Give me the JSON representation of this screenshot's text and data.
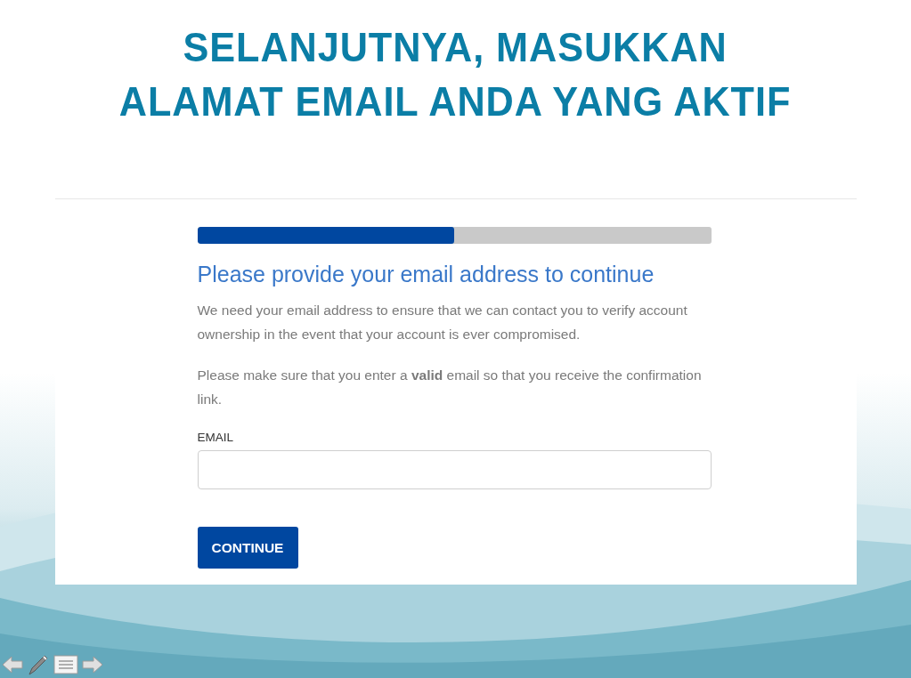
{
  "slide": {
    "title_lines": [
      "SELANJUTNYA, MASUKKAN",
      "ALAMAT EMAIL ANDA YANG AKTIF"
    ]
  },
  "form": {
    "progress": {
      "level": 0.5
    },
    "heading": "Please provide your email address to continue",
    "paragraphs": [
      "We need your email address to ensure that we can contact you to verify account ownership in the event that your account is ever compromised.",
      "Please make sure that you enter a **valid** email so that you receive the confirmation link."
    ],
    "email_field": {
      "label": "EMAIL"
    },
    "button": "CONTINUE"
  }
}
